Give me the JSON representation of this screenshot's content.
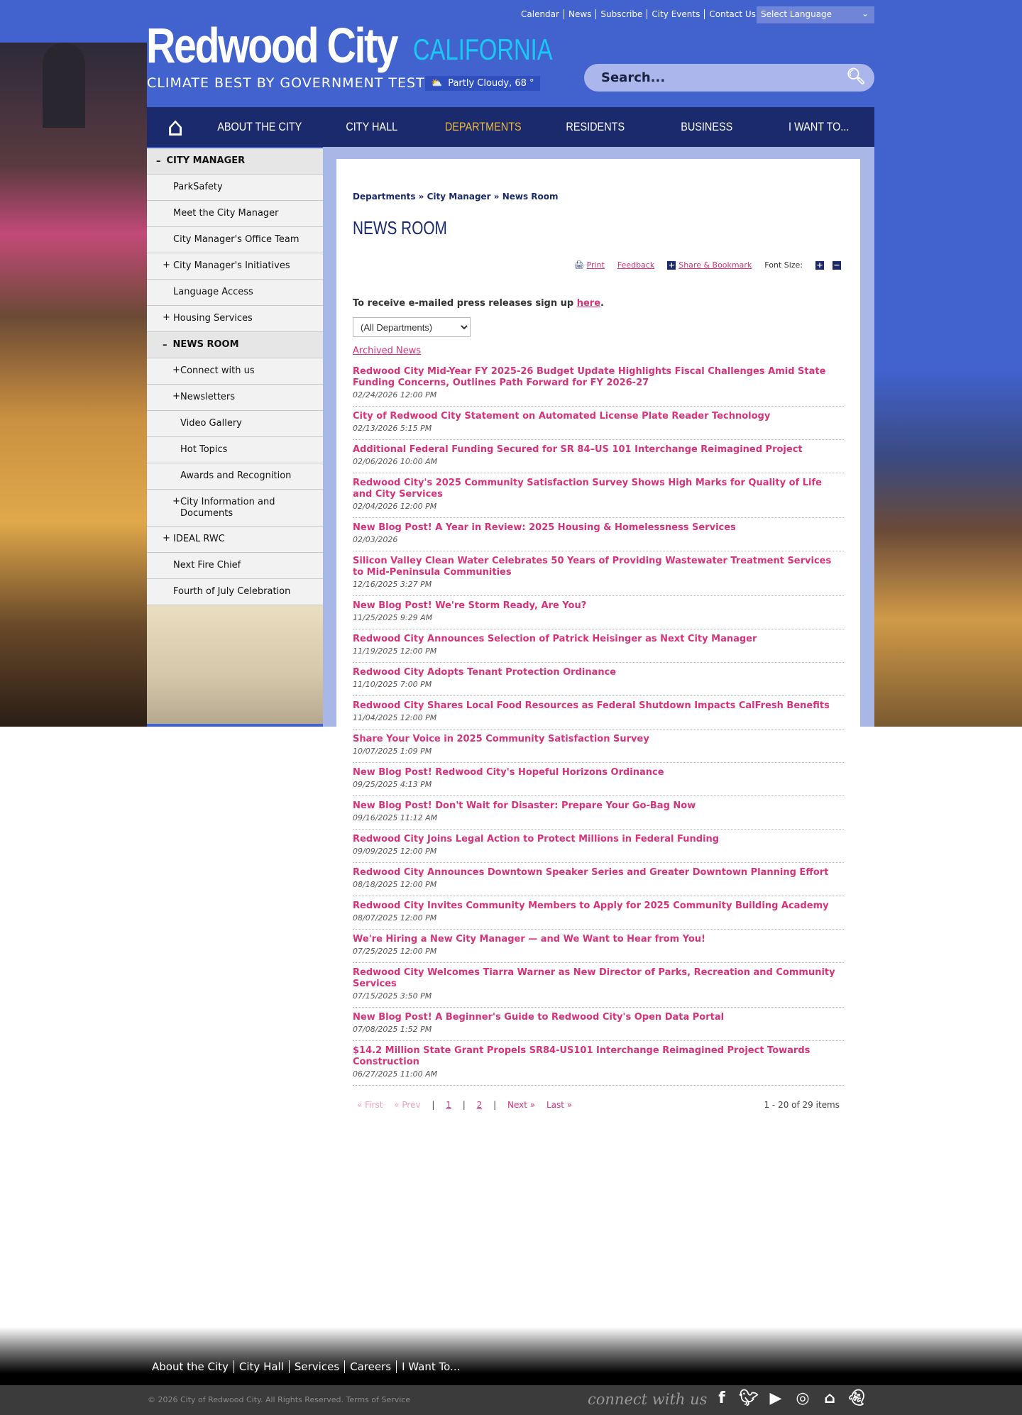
{
  "top_links": [
    "Calendar",
    "News",
    "Subscribe",
    "City Events",
    "Contact Us"
  ],
  "language": "Select Language",
  "logo": {
    "name": "Redwood City",
    "state": "CALIFORNIA",
    "tagline": "CLIMATE BEST BY GOVERNMENT TEST"
  },
  "weather": "Partly Cloudy, 68 °",
  "search": {
    "placeholder": "Search..."
  },
  "nav": [
    "ABOUT THE CITY",
    "CITY HALL",
    "DEPARTMENTS",
    "RESIDENTS",
    "BUSINESS",
    "I WANT TO..."
  ],
  "sidebar": [
    {
      "label": "City Manager",
      "type": "head",
      "pm": "–"
    },
    {
      "label": "ParkSafety"
    },
    {
      "label": "Meet the City Manager"
    },
    {
      "label": "City Manager's Office Team"
    },
    {
      "label": "City Manager's Initiatives",
      "pm": "+"
    },
    {
      "label": "Language Access"
    },
    {
      "label": "Housing Services",
      "pm": "+"
    },
    {
      "label": "News Room",
      "type": "head2",
      "pm": "–"
    },
    {
      "label": "Connect with us",
      "type": "sub",
      "pm": "+"
    },
    {
      "label": "Newsletters",
      "type": "sub",
      "pm": "+"
    },
    {
      "label": "Video Gallery",
      "type": "sub"
    },
    {
      "label": "Hot Topics",
      "type": "sub"
    },
    {
      "label": "Awards and Recognition",
      "type": "sub"
    },
    {
      "label": "City Information and Documents",
      "type": "sub",
      "pm": "+"
    },
    {
      "label": "IDEAL RWC",
      "pm": "+"
    },
    {
      "label": "Next Fire Chief"
    },
    {
      "label": "Fourth of July Celebration"
    }
  ],
  "breadcrumb": "Departments » City Manager » News Room",
  "title": "NEWS ROOM",
  "tools": {
    "print": "Print",
    "feedback": "Feedback",
    "share": "Share & Bookmark",
    "font_size": "Font Size:"
  },
  "signup": {
    "text": "To receive e-mailed press releases sign up ",
    "link": "here",
    "end": "."
  },
  "filter": "(All Departments)",
  "archived": "Archived News",
  "news": [
    {
      "t": "Redwood City Mid-Year FY 2025-26 Budget Update Highlights Fiscal Challenges Amid State Funding Concerns, Outlines Path Forward for FY 2026-27",
      "d": "02/24/2026 12:00 PM"
    },
    {
      "t": "City of Redwood City Statement on Automated License Plate Reader Technology",
      "d": "02/13/2026 5:15 PM"
    },
    {
      "t": "Additional Federal Funding Secured for SR 84–US 101 Interchange Reimagined Project",
      "d": "02/06/2026 10:00 AM"
    },
    {
      "t": "Redwood City's 2025 Community Satisfaction Survey Shows High Marks for Quality of Life and City Services",
      "d": "02/04/2026 12:00 PM"
    },
    {
      "t": "New Blog Post! A Year in Review: 2025 Housing & Homelessness Services",
      "d": "02/03/2026"
    },
    {
      "t": "Silicon Valley Clean Water Celebrates 50 Years of Providing Wastewater Treatment Services to Mid-Peninsula Communities",
      "d": "12/16/2025 3:27 PM"
    },
    {
      "t": "New Blog Post! We're Storm Ready, Are You?",
      "d": "11/25/2025 9:29 AM"
    },
    {
      "t": "Redwood City Announces Selection of Patrick Heisinger as Next City Manager",
      "d": "11/19/2025 12:00 PM"
    },
    {
      "t": "Redwood City Adopts Tenant Protection Ordinance",
      "d": "11/10/2025 7:00 PM"
    },
    {
      "t": "Redwood City Shares Local Food Resources as Federal Shutdown Impacts CalFresh Benefits",
      "d": "11/04/2025 12:00 PM"
    },
    {
      "t": "Share Your Voice in 2025 Community Satisfaction Survey",
      "d": "10/07/2025 1:09 PM"
    },
    {
      "t": "New Blog Post! Redwood City's Hopeful Horizons Ordinance",
      "d": "09/25/2025 4:13 PM"
    },
    {
      "t": "New Blog Post! Don't Wait for Disaster: Prepare Your Go-Bag Now",
      "d": "09/16/2025 11:12 AM"
    },
    {
      "t": "Redwood City Joins Legal Action to Protect Millions in Federal Funding",
      "d": "09/09/2025 12:00 PM"
    },
    {
      "t": "Redwood City Announces Downtown Speaker Series and Greater Downtown Planning Effort",
      "d": "08/18/2025 12:00 PM"
    },
    {
      "t": "Redwood City Invites Community Members to Apply for 2025 Community Building Academy",
      "d": "08/07/2025 12:00 PM"
    },
    {
      "t": "We're Hiring a New City Manager — and We Want to Hear from You!",
      "d": "07/25/2025 12:00 PM"
    },
    {
      "t": "Redwood City Welcomes Tiarra Warner as New Director of Parks, Recreation and Community Services",
      "d": "07/15/2025 3:50 PM"
    },
    {
      "t": "New Blog Post! A Beginner's Guide to Redwood City's Open Data Portal",
      "d": "07/08/2025 1:52 PM"
    },
    {
      "t": "$14.2 Million State Grant Propels SR84-US101 Interchange Reimagined Project Towards Construction",
      "d": "06/27/2025 11:00 AM"
    }
  ],
  "pager": {
    "first": "« First",
    "prev": "« Prev",
    "p1": "1",
    "p2": "2",
    "next": "Next »",
    "last": "Last »",
    "count": "1 - 20 of 29 items"
  },
  "footer": {
    "links": [
      "About the City",
      "City Hall",
      "Services",
      "Careers",
      "I Want To..."
    ],
    "copyright": "© 2026 City of Redwood City. All Rights Reserved. Terms of Service",
    "connect": "connect with us"
  },
  "colors": {
    "brand": "#4262ce",
    "nav": "#1a2a6c",
    "link": "#d6337a",
    "active": "#f0b93a"
  }
}
